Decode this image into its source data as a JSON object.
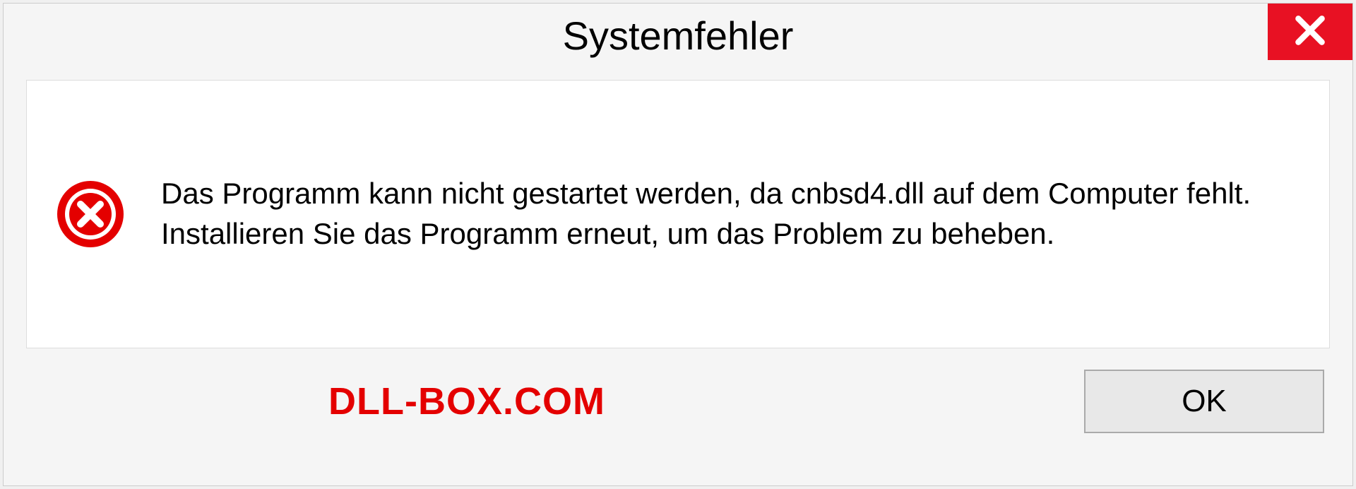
{
  "dialog": {
    "title": "Systemfehler",
    "message": "Das Programm kann nicht gestartet werden, da cnbsd4.dll auf dem Computer fehlt. Installieren Sie das Programm erneut, um das Problem zu beheben.",
    "ok_label": "OK"
  },
  "watermark": "DLL-BOX.COM",
  "colors": {
    "close_bg": "#e81123",
    "error_icon": "#e40000",
    "watermark": "#e40000"
  }
}
